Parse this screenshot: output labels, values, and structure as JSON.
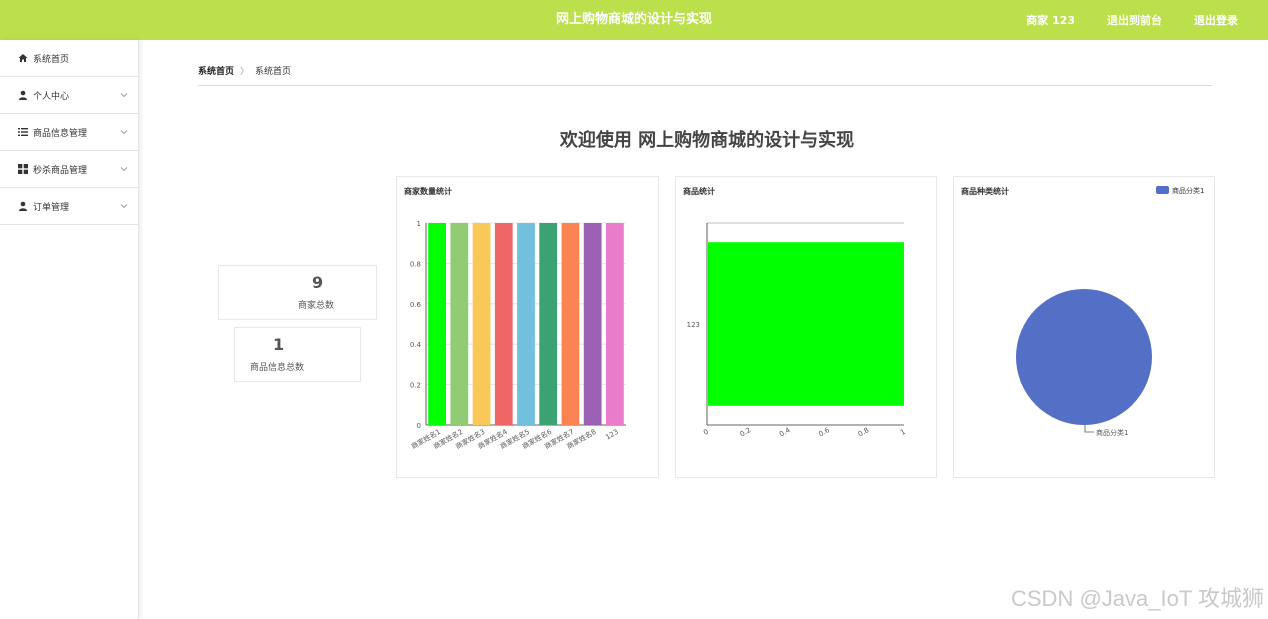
{
  "header": {
    "title": "网上购物商城的设计与实现",
    "user": "商家 123",
    "back_to_admin": "退出到前台",
    "logout": "退出登录"
  },
  "sidebar": {
    "items": [
      {
        "label": "系统首页",
        "icon": "home-icon",
        "expandable": false
      },
      {
        "label": "个人中心",
        "icon": "user-icon",
        "expandable": true
      },
      {
        "label": "商品信息管理",
        "icon": "list-icon",
        "expandable": true
      },
      {
        "label": "秒杀商品管理",
        "icon": "grid-icon",
        "expandable": true
      },
      {
        "label": "订单管理",
        "icon": "user-icon",
        "expandable": true
      }
    ]
  },
  "breadcrumb": {
    "home": "系统首页",
    "separator": "〉",
    "current": "系统首页"
  },
  "welcome": "欢迎使用 网上购物商城的设计与实现",
  "stats": [
    {
      "value": "9",
      "label": "商家总数"
    },
    {
      "value": "1",
      "label": "商品信息总数"
    }
  ],
  "panels": {
    "merchant_title": "商家数量统计",
    "goods_title": "商品统计",
    "category_title": "商品种类统计"
  },
  "watermark": "CSDN @Java_IoT 攻城狮",
  "chart_data": [
    {
      "type": "bar",
      "title": "商家数量统计",
      "categories": [
        "商家姓名1",
        "商家姓名2",
        "商家姓名3",
        "商家姓名4",
        "商家姓名5",
        "商家姓名6",
        "商家姓名7",
        "商家姓名8",
        "123"
      ],
      "values": [
        1,
        1,
        1,
        1,
        1,
        1,
        1,
        1,
        1
      ],
      "colors": [
        "#00ff00",
        "#91cc75",
        "#fac858",
        "#ee6666",
        "#73c0de",
        "#3ba272",
        "#fc8452",
        "#9a60b4",
        "#ea7ccc"
      ],
      "ylim": [
        0,
        1
      ],
      "yticks": [
        "0",
        "0.2",
        "0.4",
        "0.6",
        "0.8",
        "1"
      ],
      "grid": true
    },
    {
      "type": "bar",
      "orientation": "horizontal",
      "title": "商品统计",
      "categories": [
        "123"
      ],
      "values": [
        1
      ],
      "colors": [
        "#00ff00"
      ],
      "xlim": [
        0,
        1
      ],
      "xticks": [
        "0",
        "0.2",
        "0.4",
        "0.6",
        "0.8",
        "1"
      ]
    },
    {
      "type": "pie",
      "title": "商品种类统计",
      "labels": [
        "商品分类1"
      ],
      "values": [
        1
      ],
      "colors": [
        "#5470c6"
      ],
      "legend": "top-right"
    }
  ]
}
